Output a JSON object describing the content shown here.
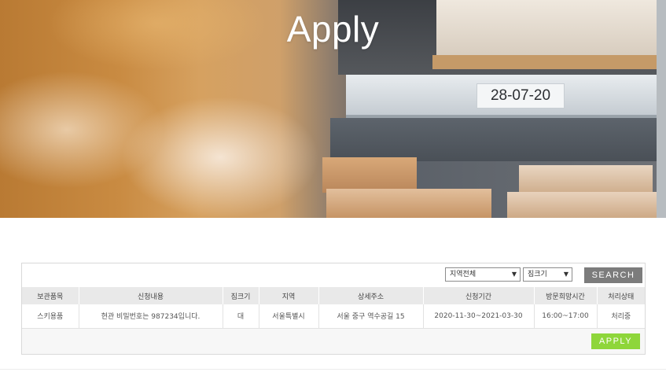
{
  "hero": {
    "title": "Apply",
    "shelf_label": "28-07-20"
  },
  "filters": {
    "region": {
      "selected": "지역전체"
    },
    "size": {
      "selected": "짐크기"
    },
    "search_label": "SEARCH"
  },
  "table": {
    "headers": [
      "보관품목",
      "신청내용",
      "짐크기",
      "지역",
      "상세주소",
      "신청기간",
      "방문희망시간",
      "처리상태"
    ],
    "rows": [
      [
        "스키용품",
        "현관 비밀번호는 987234입니다.",
        "대",
        "서울특별시",
        "서울 중구 역수공길 15",
        "2020-11-30~2021-03-30",
        "16:00~17:00",
        "처리중"
      ]
    ]
  },
  "apply_label": "APPLY",
  "colors": {
    "search_button": "#7c7c7c",
    "apply_button": "#8ed63a",
    "header_bg": "#e9e9e9"
  }
}
